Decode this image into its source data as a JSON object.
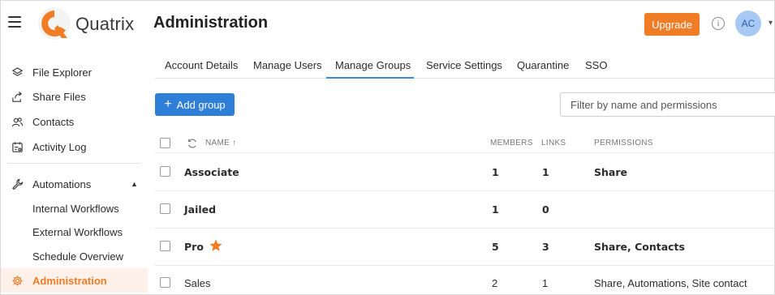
{
  "app": {
    "brand": "Quatrix",
    "page_title": "Administration",
    "upgrade_label": "Upgrade",
    "info_symbol": "i",
    "avatar_initials": "AC",
    "brand_color": "#f07c26",
    "accent_color": "#2f7fd9"
  },
  "sidebar": {
    "items": [
      {
        "label": "File Explorer",
        "icon": "layers-icon"
      },
      {
        "label": "Share Files",
        "icon": "share-arrow-icon"
      },
      {
        "label": "Contacts",
        "icon": "contacts-icon"
      },
      {
        "label": "Activity Log",
        "icon": "activity-log-icon"
      }
    ],
    "automations": {
      "label": "Automations",
      "icon": "wrench-icon",
      "expanded": true
    },
    "sub_items": [
      {
        "label": "Internal Workflows"
      },
      {
        "label": "External Workflows"
      },
      {
        "label": "Schedule Overview"
      }
    ],
    "administration": {
      "label": "Administration",
      "icon": "gear-icon",
      "active": true
    }
  },
  "tabs": [
    {
      "label": "Account Details"
    },
    {
      "label": "Manage Users"
    },
    {
      "label": "Manage Groups",
      "active": true
    },
    {
      "label": "Service Settings"
    },
    {
      "label": "Quarantine"
    },
    {
      "label": "SSO"
    }
  ],
  "toolbar": {
    "add_group_label": "Add group",
    "add_symbol": "+",
    "filter_placeholder": "Filter by name and permissions"
  },
  "table": {
    "columns": {
      "name": "NAME ↑",
      "members": "MEMBERS",
      "links": "LINKS",
      "permissions": "PERMISSIONS"
    },
    "rows": [
      {
        "name": "Associate",
        "members": "1",
        "links": "1",
        "permissions": "Share",
        "bold": true,
        "starred": false
      },
      {
        "name": "Jailed",
        "members": "1",
        "links": "0",
        "permissions": "",
        "bold": true,
        "starred": false
      },
      {
        "name": "Pro",
        "members": "5",
        "links": "3",
        "permissions": "Share, Contacts",
        "bold": true,
        "starred": true
      },
      {
        "name": "Sales",
        "members": "2",
        "links": "1",
        "permissions": "Share, Automations, Site contact",
        "bold": false,
        "starred": false
      }
    ]
  }
}
